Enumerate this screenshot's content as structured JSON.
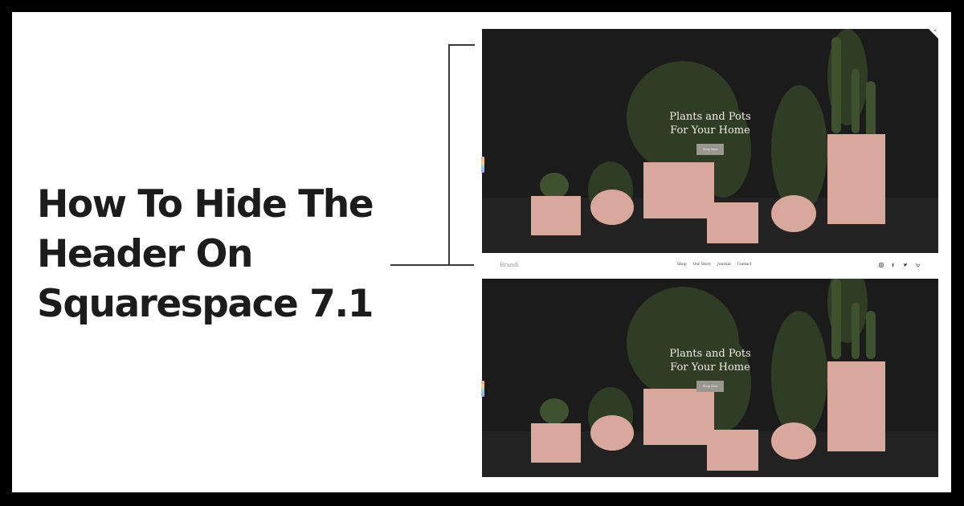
{
  "headline": [
    "How To Hide The",
    "Header On",
    "Squarespace 7.1"
  ],
  "hero": {
    "title_line1": "Plants and Pots",
    "title_line2": "For Your Home",
    "button_label": "Shop Now"
  },
  "nav": {
    "logo": "Brandi",
    "links": [
      "Shop",
      "Our Story",
      "Journal",
      "Contact"
    ],
    "icons": [
      "instagram-icon",
      "facebook-icon",
      "twitter-icon",
      "cart-icon"
    ]
  },
  "colors": {
    "background": "#000000",
    "card": "#ffffff",
    "headline": "#1c1c1c",
    "pot": "#d9a89c",
    "scene_dark": "#1a1a1a",
    "button": "#9a9690"
  }
}
